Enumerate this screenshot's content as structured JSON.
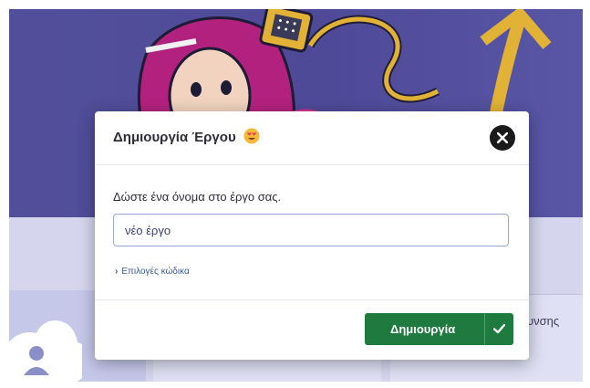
{
  "modal": {
    "title": "Δημιουργία Έργου",
    "title_icon": "heart-eyes-emoji-icon",
    "close_icon": "close-icon",
    "prompt": "Δώστε ένα όνομα στο έργο σας.",
    "project_name_value": "νέο έργο",
    "code_options_label": "Επιλογές κώδικα",
    "code_options_icon": "chevron-right-icon",
    "create_label": "Δημιουργία",
    "create_icon": "checkmark-icon"
  },
  "background": {
    "card_partial_text": "υνσης",
    "cloud_icon": "cloud-user-icon"
  },
  "colors": {
    "primary_button": "#1f7a3f",
    "input_border": "#9aa6d8",
    "link": "#3c5a9c",
    "hero": "#524f9a"
  }
}
